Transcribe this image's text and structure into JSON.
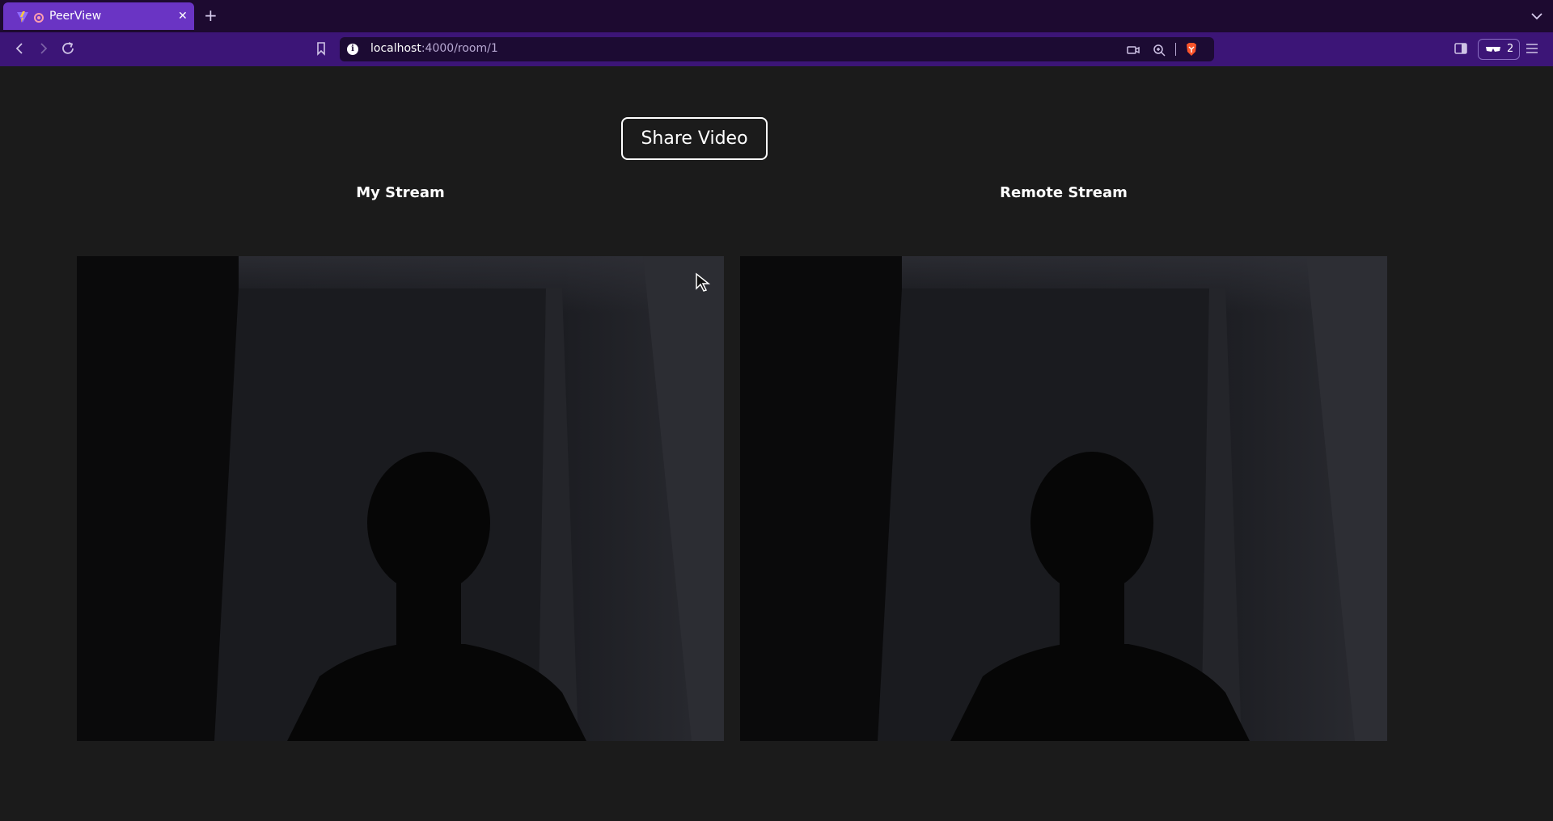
{
  "browser": {
    "tab": {
      "title": "PeerView",
      "close": "✕"
    },
    "new_tab": "+",
    "url": {
      "host": "localhost",
      "path": ":4000/room/1"
    },
    "wallet_count": "2"
  },
  "page": {
    "share_button": "Share Video",
    "my_stream_label": "My Stream",
    "remote_stream_label": "Remote Stream"
  },
  "colors": {
    "tab_active": "#6a34c4",
    "toolbar": "#3c1577",
    "page_bg": "#1b1b1b"
  }
}
